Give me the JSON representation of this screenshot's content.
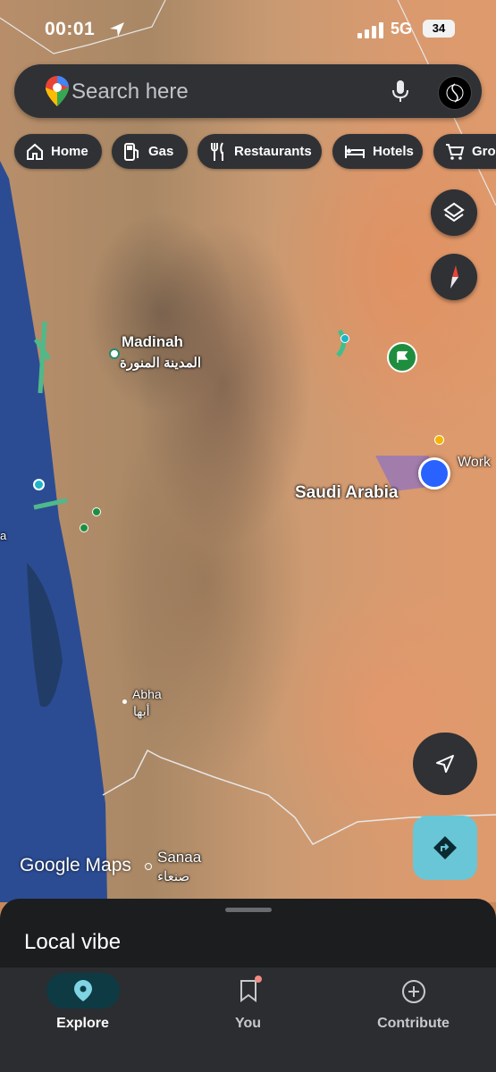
{
  "status": {
    "time": "00:01",
    "network": "5G",
    "battery": "34"
  },
  "search": {
    "placeholder": "Search here"
  },
  "chips": [
    {
      "label": "Home",
      "icon": "home-icon"
    },
    {
      "label": "Gas",
      "icon": "gas-station-icon"
    },
    {
      "label": "Restaurants",
      "icon": "fork-knife-icon"
    },
    {
      "label": "Hotels",
      "icon": "bed-icon"
    },
    {
      "label": "Gro",
      "icon": "cart-icon"
    }
  ],
  "map": {
    "labels": {
      "madinah_en": "Madinah",
      "madinah_ar": "المدينة المنورة",
      "saudi": "Saudi Arabia",
      "work": "Work",
      "abha_en": "Abha",
      "abha_ar": "أبها",
      "sanaa_en": "Sanaa",
      "sanaa_ar": "صنعاء",
      "edge": "a"
    },
    "watermark": "Google Maps"
  },
  "sheet": {
    "title": "Local vibe"
  },
  "nav": {
    "explore": "Explore",
    "you": "You",
    "contribute": "Contribute"
  },
  "colors": {
    "accent": "#69c6d6",
    "nav_bg": "#2b2d31",
    "chip_bg": "#2f3135"
  }
}
